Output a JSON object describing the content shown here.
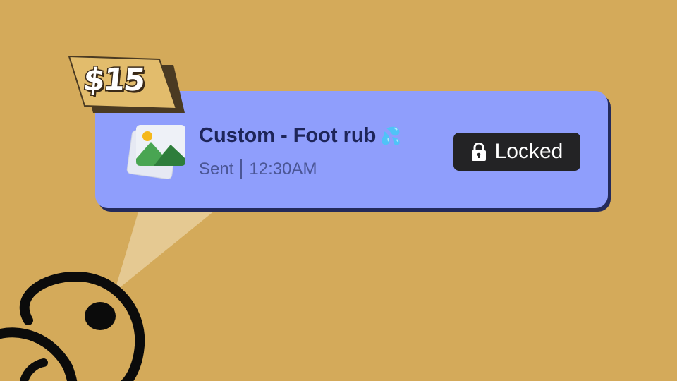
{
  "price": {
    "label": "$15"
  },
  "message": {
    "title": "Custom - Foot rub",
    "emoji": "💦",
    "status": "Sent",
    "time": "12:30AM",
    "media_icon": "image-gallery-icon"
  },
  "unlock_button": {
    "label": "Locked",
    "icon": "lock-icon"
  },
  "colors": {
    "background": "#d4aa5a",
    "card": "#8f9efc",
    "card_shadow": "#242a5a",
    "title": "#1e2559",
    "button": "#232325",
    "price_tag": "#e2bc6c"
  }
}
